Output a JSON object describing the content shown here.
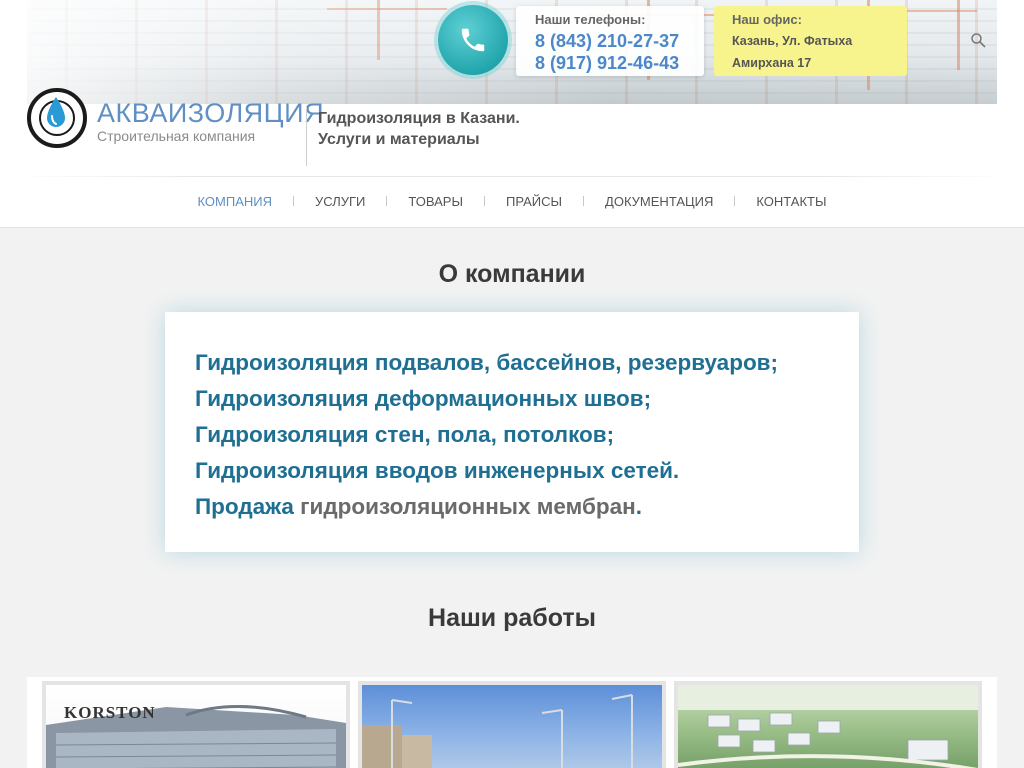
{
  "header": {
    "brand_name": "АКВАИЗОЛЯЦИЯ",
    "brand_subtitle": "Строительная компания",
    "tagline_line1": "Гидроизоляция в Казани.",
    "tagline_line2": "Услуги и материалы",
    "phones_title": "Наши телефоны:",
    "phone_1": "8 (843) 210-27-37",
    "phone_2": "8 (917) 912-46-43",
    "office_title": "Наш офис:",
    "office_line1": "Казань, Ул. Фатыха",
    "office_line2": "Амирхана 17"
  },
  "nav": {
    "items": [
      {
        "label": "Компания",
        "active": true
      },
      {
        "label": "Услуги"
      },
      {
        "label": "Товары"
      },
      {
        "label": "Прайсы"
      },
      {
        "label": "Документация"
      },
      {
        "label": "Контакты"
      }
    ]
  },
  "about": {
    "title": "О компании",
    "lines": [
      "Гидроизоляция подвалов, бассейнов, резервуаров;",
      "Гидроизоляция деформационных швов;",
      "Гидроизоляция стен, пола, потолков;",
      "Гидроизоляция вводов инженерных сетей."
    ],
    "last_line_prefix": "Продажа",
    "last_line_link": "гидроизоляционных мембран",
    "last_line_suffix": "."
  },
  "works": {
    "title": "Наши работы",
    "items": [
      {
        "caption": "KORSTON"
      }
    ]
  },
  "colors": {
    "accent": "#5f8fc4",
    "teal": "#22a6ad",
    "about_text": "#1f6f93",
    "office_bg": "#f7f48e"
  },
  "icons": {
    "phone": "phone-icon",
    "search": "search-icon",
    "logo": "water-drop-logo-icon"
  }
}
